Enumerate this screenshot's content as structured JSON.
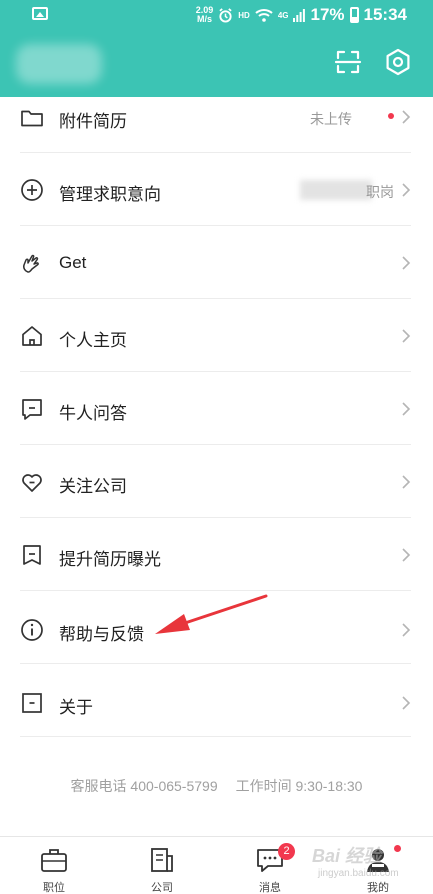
{
  "status_bar": {
    "speed_value": "2.09",
    "speed_unit": "M/s",
    "hd": "HD",
    "network": "4G",
    "battery": "17%",
    "time": "15:34"
  },
  "header": {
    "icons": [
      "scan-icon",
      "settings-hexagon-icon"
    ]
  },
  "menu": {
    "items": [
      {
        "label": "附件简历",
        "value": "未上传",
        "icon": "folder-icon",
        "has_dot": true
      },
      {
        "label": "管理求职意向",
        "value": "职岗",
        "icon": "plus-circle-icon",
        "has_dot": false
      },
      {
        "label": "Get",
        "value": "",
        "icon": "hand-gesture-icon",
        "has_dot": false
      },
      {
        "label": "个人主页",
        "value": "",
        "icon": "home-icon",
        "has_dot": false
      },
      {
        "label": "牛人问答",
        "value": "",
        "icon": "chat-square-icon",
        "has_dot": false
      },
      {
        "label": "关注公司",
        "value": "",
        "icon": "heart-icon",
        "has_dot": false
      },
      {
        "label": "提升简历曝光",
        "value": "",
        "icon": "bookmark-icon",
        "has_dot": false
      },
      {
        "label": "帮助与反馈",
        "value": "",
        "icon": "info-circle-icon",
        "has_dot": false
      },
      {
        "label": "关于",
        "value": "",
        "icon": "about-square-icon",
        "has_dot": false
      }
    ]
  },
  "footer": {
    "phone": "客服电话 400-065-5799",
    "hours": "工作时间 9:30-18:30"
  },
  "tabbar": {
    "tabs": [
      {
        "label": "职位",
        "icon": "briefcase-icon"
      },
      {
        "label": "公司",
        "icon": "building-icon"
      },
      {
        "label": "消息",
        "icon": "message-icon",
        "badge": "2"
      },
      {
        "label": "我的",
        "icon": "profile-icon"
      }
    ]
  },
  "watermark": {
    "text": "Bai 经验",
    "sub": "jingyan.baidu.com"
  },
  "colors": {
    "header": "#3cc4b4",
    "accent_red": "#f2384e",
    "annotation_arrow": "#e8353b"
  }
}
